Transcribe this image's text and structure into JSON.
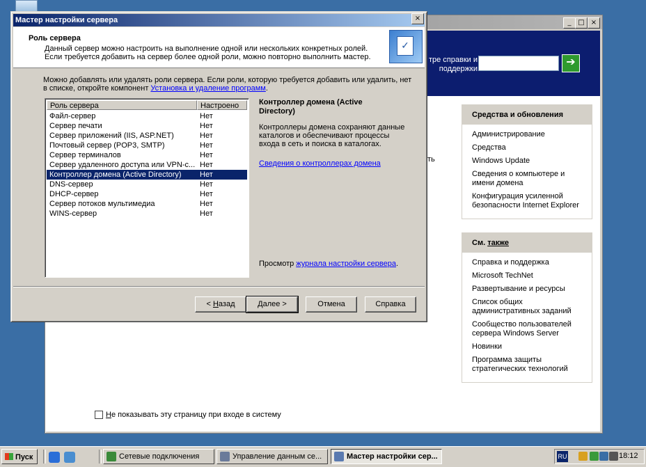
{
  "background_window": {
    "help_label": "тре справки и поддержки",
    "panel1": {
      "title": "Средства и обновления",
      "items": [
        "Администрирование",
        "Средства",
        "Windows Update",
        "Сведения о компьютере и имени домена",
        "Конфигурация усиленной безопасности Internet Explorer"
      ]
    },
    "panel2": {
      "title_prefix": "См. ",
      "title_underlined": "также",
      "items": [
        "Справка и поддержка",
        "Microsoft TechNet",
        "Развертывание и ресурсы",
        "Список общих административных заданий",
        "Сообщество пользователей сервера Windows Server",
        "Новинки",
        "Программа защиты стратегических технологий"
      ]
    },
    "text_stub": "ть",
    "dont_show_prefix": "Н",
    "dont_show_rest": "е показывать эту страницу при входе в систему"
  },
  "wizard": {
    "title": "Мастер настройки сервера",
    "header_title": "Роль сервера",
    "header_desc": "Данный сервер можно настроить на выполнение одной или нескольких конкретных ролей. Если требуется добавить на сервер более одной роли, можно повторно выполнить мастер.",
    "intro": "Можно добавлять или удалять роли сервера. Если роли, которую требуется добавить или удалить, нет в списке, откройте компонент ",
    "intro_link": "Установка и удаление программ",
    "intro_end": ".",
    "columns": [
      "Роль сервера",
      "Настроено"
    ],
    "roles": [
      {
        "name": "Файл-сервер",
        "status": "Нет"
      },
      {
        "name": "Сервер печати",
        "status": "Нет"
      },
      {
        "name": "Сервер приложений (IIS, ASP.NET)",
        "status": "Нет"
      },
      {
        "name": "Почтовый сервер (POP3, SMTP)",
        "status": "Нет"
      },
      {
        "name": "Сервер терминалов",
        "status": "Нет"
      },
      {
        "name": "Сервер удаленного доступа или VPN-с...",
        "status": "Нет"
      },
      {
        "name": "Контроллер домена (Active Directory)",
        "status": "Нет"
      },
      {
        "name": "DNS-сервер",
        "status": "Нет"
      },
      {
        "name": "DHCP-сервер",
        "status": "Нет"
      },
      {
        "name": "Сервер потоков мультимедиа",
        "status": "Нет"
      },
      {
        "name": "WINS-сервер",
        "status": "Нет"
      }
    ],
    "selected_role": "Контроллер домена (Active Directory)",
    "info_title": "Контроллер домена (Active Directory)",
    "info_desc": "Контроллеры домена сохраняют данные каталогов и обеспечивают процессы входа в сеть и поиска в каталогах.",
    "info_link": "Сведения о контроллерах домена",
    "log_prefix": "Просмотр ",
    "log_link": "журнала настройки сервера",
    "log_end": ".",
    "buttons": {
      "back_prefix": "< ",
      "back_u": "Н",
      "back_rest": "азад",
      "next_u": "Д",
      "next_rest": "алее >",
      "cancel": "Отмена",
      "help": "Справка"
    }
  },
  "taskbar": {
    "start": "Пуск",
    "tasks": [
      "Сетевые подключения",
      "Управление данным се...",
      "Мастер настройки сер..."
    ],
    "lang": "RU",
    "clock": "18:12"
  },
  "colors": {
    "desktop": "#3a6ea5",
    "title_active": "#0a246a",
    "banner": "#0c1d6f",
    "selection": "#0a246a",
    "link": "#0000ff"
  }
}
